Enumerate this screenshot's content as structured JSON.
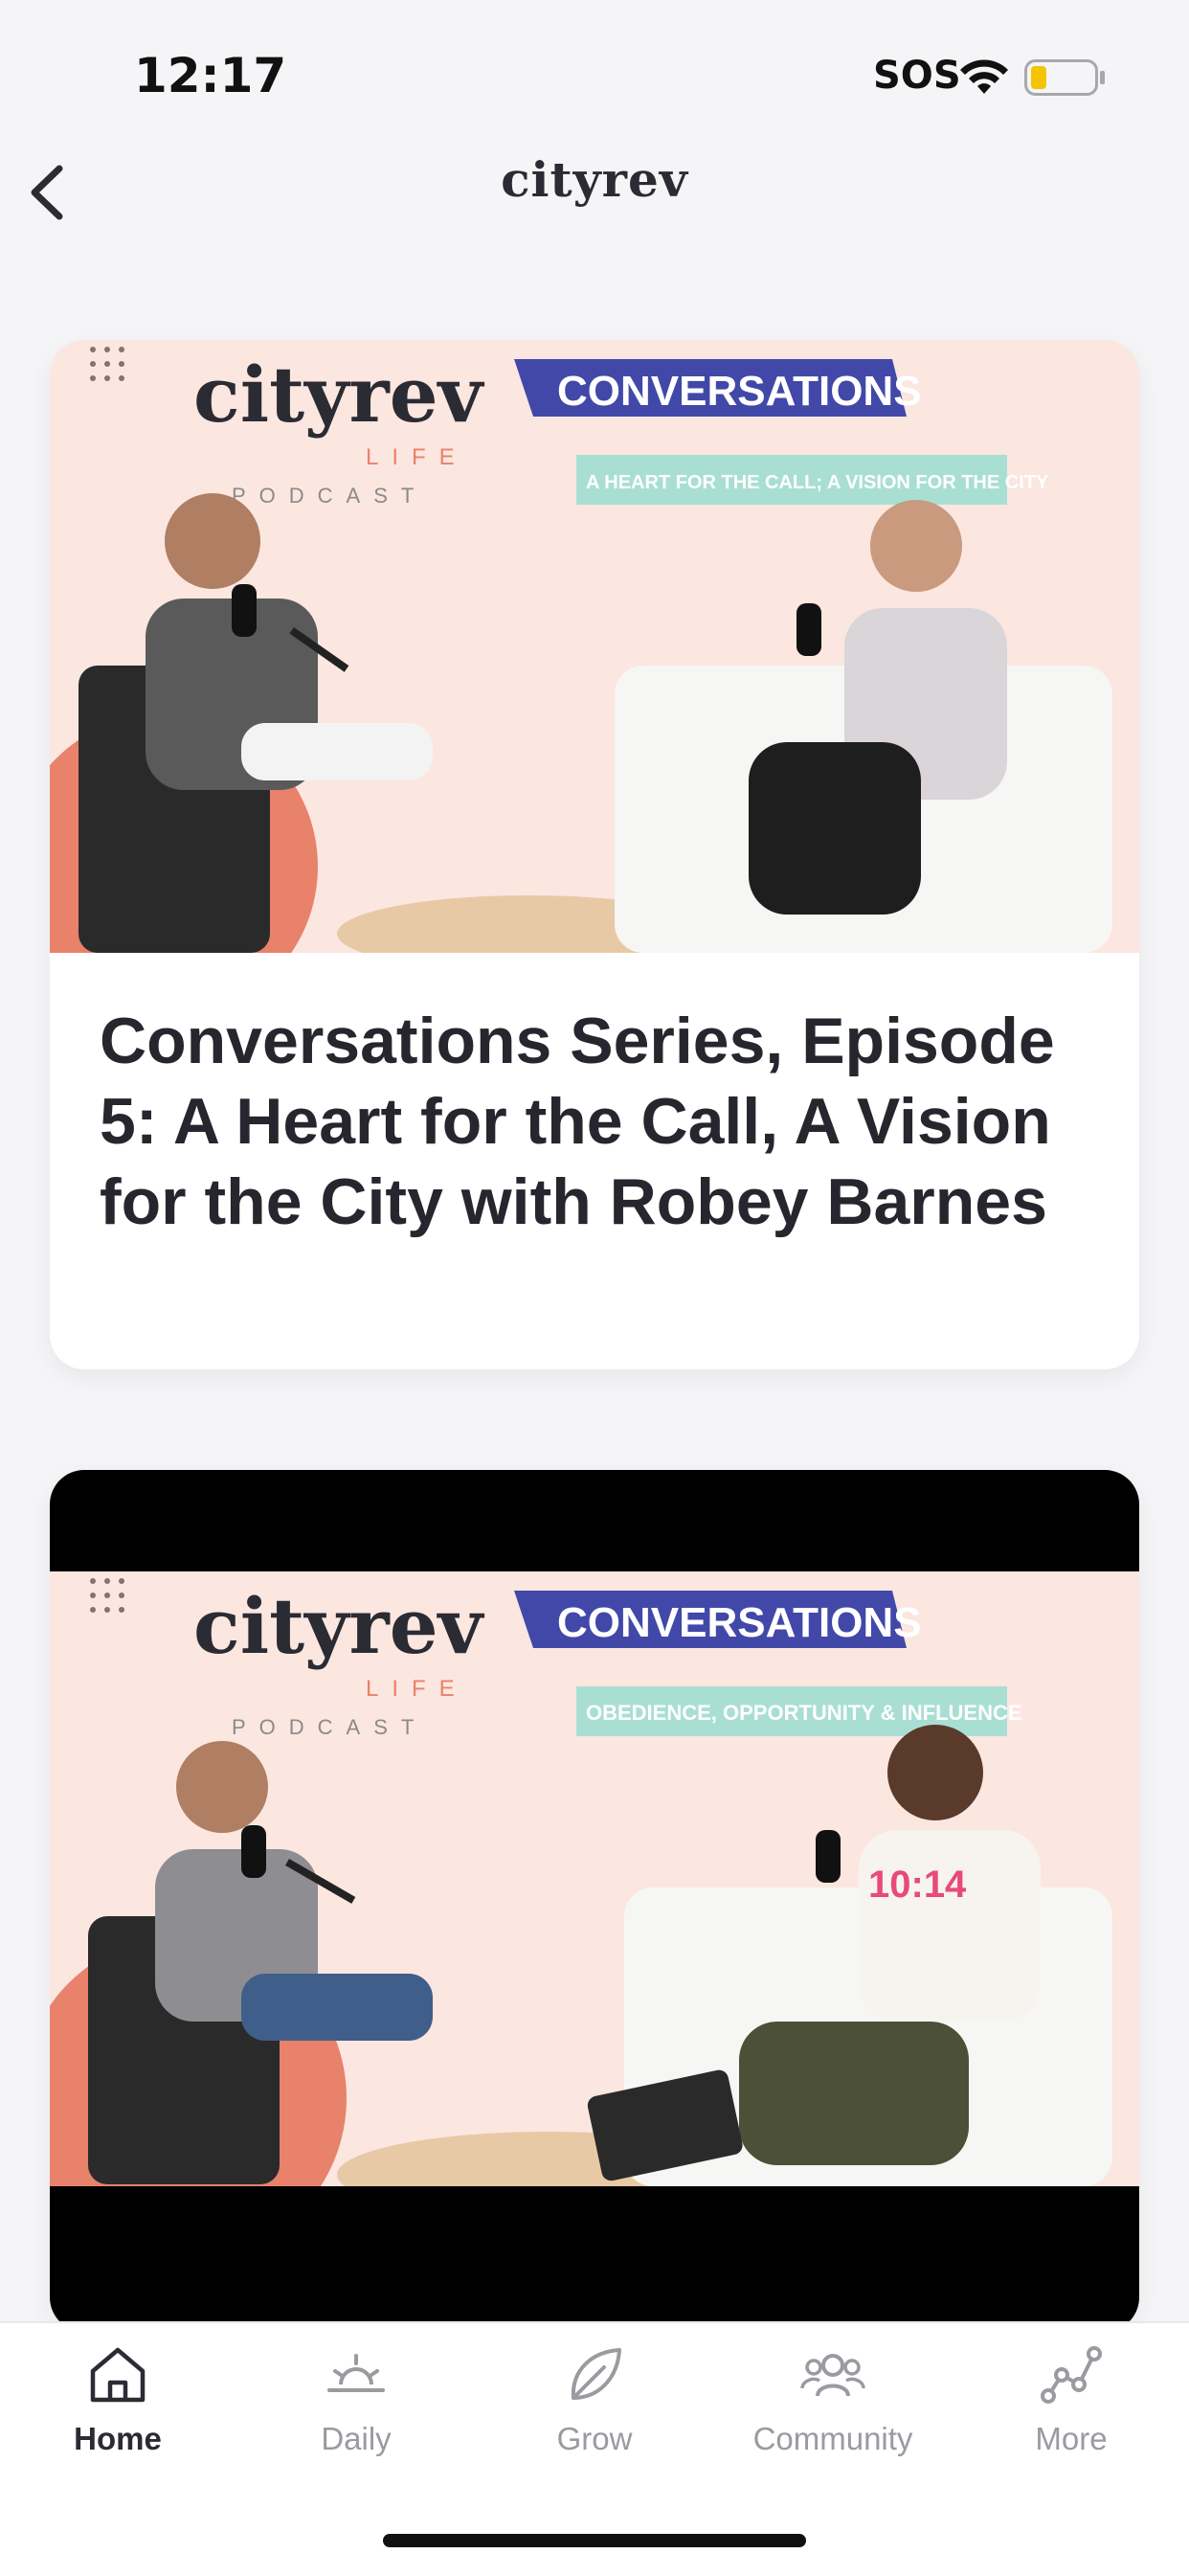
{
  "status_bar": {
    "time": "12:17",
    "sos": "SOS"
  },
  "header": {
    "brand": "cityrev"
  },
  "cards": [
    {
      "title": "Conversations Series, Episode 5: A Heart for the Call, A Vision for the City with Robey Barnes",
      "thumb": {
        "brand": "cityrev",
        "brand_sub": "LIFE",
        "brand_sub2": "PODCAST",
        "badge": "CONVERSATIONS",
        "subtitle": "A HEART FOR THE CALL; A VISION FOR THE CITY"
      }
    },
    {
      "thumb": {
        "brand": "cityrev",
        "brand_sub": "LIFE",
        "brand_sub2": "PODCAST",
        "badge": "CONVERSATIONS",
        "subtitle": "OBEDIENCE, OPPORTUNITY & INFLUENCE"
      }
    }
  ],
  "tabs": [
    {
      "label": "Home",
      "icon": "home-icon",
      "active": true
    },
    {
      "label": "Daily",
      "icon": "sunrise-icon"
    },
    {
      "label": "Grow",
      "icon": "leaf-icon"
    },
    {
      "label": "Community",
      "icon": "people-icon"
    },
    {
      "label": "More",
      "icon": "graph-icon"
    }
  ],
  "colors": {
    "accent_blue": "#4148a8",
    "mint": "#a9dfd3",
    "peach_bg": "#fbe6e0",
    "coral": "#e8826a"
  }
}
